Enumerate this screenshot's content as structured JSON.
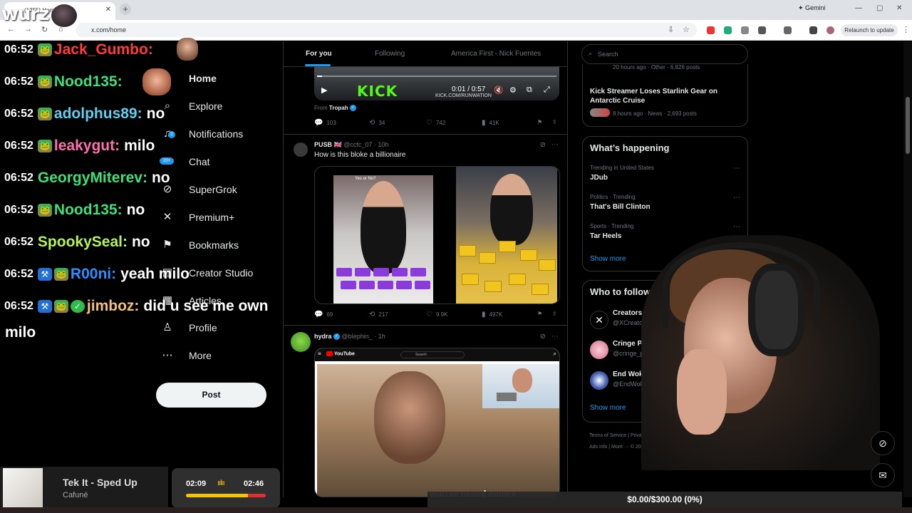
{
  "browser": {
    "tab_title": "(1355) Home",
    "tab_close": "✕",
    "new_tab": "+",
    "url": "x.com/home",
    "gemini_label": "Gemini",
    "relaunch_label": "Relaunch to update"
  },
  "overlay": {
    "logo_text": "wurz"
  },
  "chat": {
    "messages": [
      {
        "time": "06:52",
        "user": "Jack_Gumbo",
        "sep": ":",
        "msg": "",
        "color": "#ff3b3b",
        "badges": [
          "frog"
        ]
      },
      {
        "time": "06:52",
        "user": "Nood135",
        "sep": ":",
        "msg": "",
        "color": "#3ee07a",
        "badges": [
          "frog"
        ]
      },
      {
        "time": "06:52",
        "user": "adolphus89",
        "sep": ":",
        "msg": "no",
        "color": "#5fd0f0",
        "badges": [
          "frog"
        ]
      },
      {
        "time": "06:52",
        "user": "leakygut",
        "sep": ":",
        "msg": "milo",
        "color": "#ff6fae",
        "badges": [
          "frog"
        ]
      },
      {
        "time": "06:52",
        "user": "GeorgyMiterev",
        "sep": ":",
        "msg": "no",
        "color": "#3ee07a",
        "badges": []
      },
      {
        "time": "06:52",
        "user": "Nood135",
        "sep": ":",
        "msg": "no",
        "color": "#3ee07a",
        "badges": [
          "frog"
        ]
      },
      {
        "time": "06:52",
        "user": "SpookySeal",
        "sep": ":",
        "msg": "no",
        "color": "#b6f35a",
        "badges": []
      },
      {
        "time": "06:52",
        "user": "R00ni",
        "sep": ":",
        "msg": "yeah milo",
        "color": "#2f8dff",
        "badges": [
          "hammer",
          "frog"
        ]
      },
      {
        "time": "06:52",
        "user": "jimboz",
        "sep": ":",
        "msg": "did u see me own",
        "color": "#f2c27a",
        "badges": [
          "hammer",
          "frog",
          "verify"
        ]
      }
    ],
    "wrap_text": "milo"
  },
  "nav": {
    "items": [
      {
        "label": "Home",
        "icon": "home-icon",
        "glyph": "⌂"
      },
      {
        "label": "Explore",
        "icon": "search-icon",
        "glyph": "⌕"
      },
      {
        "label": "Notifications",
        "icon": "bell-icon",
        "glyph": "♫"
      },
      {
        "label": "Chat",
        "icon": "chat-icon",
        "glyph": "✉"
      },
      {
        "label": "SuperGrok",
        "icon": "grok-icon",
        "glyph": "⊘"
      },
      {
        "label": "Premium+",
        "icon": "x-logo-icon",
        "glyph": "✕"
      },
      {
        "label": "Bookmarks",
        "icon": "bookmark-icon",
        "glyph": "⚑"
      },
      {
        "label": "Creator Studio",
        "icon": "creator-studio-icon",
        "glyph": "▤"
      },
      {
        "label": "Articles",
        "icon": "articles-icon",
        "glyph": "▦"
      },
      {
        "label": "Profile",
        "icon": "profile-icon",
        "glyph": "♙"
      },
      {
        "label": "More",
        "icon": "more-icon",
        "glyph": "⋯"
      }
    ],
    "notif_badge": "2",
    "chat_badge": "20+",
    "post_label": "Post"
  },
  "timeline": {
    "tabs": [
      "For you",
      "Following",
      "America First - Nick Fuentes"
    ],
    "post1": {
      "kick_text": "KICK",
      "video_time": "0:01 / 0:57",
      "video_sub": "KICK.COM/RUNWATION",
      "progress": 0.02,
      "from_prefix": "From",
      "from_name": "Tropah",
      "replies": "103",
      "reposts": "34",
      "likes": "742",
      "views": "41K"
    },
    "post2": {
      "name": "PUSB 🇬🇧",
      "handle": "@ccfc_07 · 10h",
      "text": "How is this bloke a billionaire",
      "img_label": "Yes or No?",
      "replies": "69",
      "reposts": "217",
      "likes": "9.9K",
      "views": "497K"
    },
    "post3": {
      "name": "hydra",
      "handle": "@blephin_ · 1h",
      "yt_logo": "YouTube",
      "yt_search": "Search",
      "caption": "wurzye nened money"
    }
  },
  "sidebar": {
    "search_placeholder": "Search",
    "top_trend_meta": "20 hours ago · Other · 6,826 posts",
    "top_trend_title": "Kick Streamer Loses Starlink Gear on Antarctic Cruise",
    "top_trend_sub": "8 hours ago · News · 2,693 posts",
    "happening_title": "What’s happening",
    "trends": [
      {
        "meta": "Trending in United States",
        "name": "JDub"
      },
      {
        "meta": "Politics · Trending",
        "name": "That's Bill Clinton"
      },
      {
        "meta": "Sports · Trending",
        "name": "Tar Heels"
      }
    ],
    "show_more": "Show more",
    "follow_title": "Who to follow",
    "follows": [
      {
        "name": "Creators",
        "handle": "@XCreators"
      },
      {
        "name": "Cringe Panda",
        "handle": "@cringe_panda"
      },
      {
        "name": "End Wokeness",
        "handle": "@EndWokeness"
      }
    ],
    "footer": "Terms of Service | Privacy Policy | Cookie Policy | Accessibility | Ads info | More ··· © 2025 X Corp."
  },
  "music": {
    "title": "Tek It - Sped Up",
    "artist": "Cafuné",
    "current": "02:09",
    "total": "02:46",
    "eq": "ıılıı",
    "progress": 0.78
  },
  "goal": {
    "text": "$0.00/$300.00 (0%)",
    "progress": 0
  }
}
